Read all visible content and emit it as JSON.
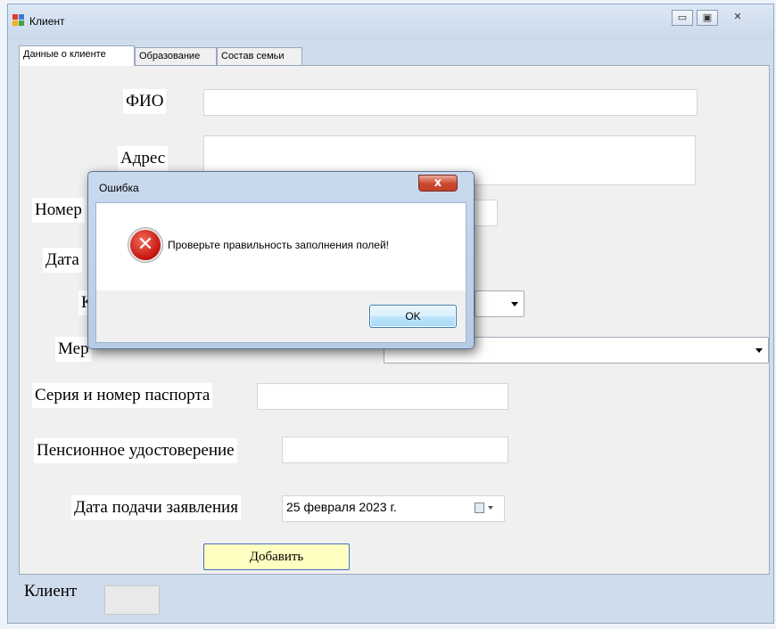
{
  "window": {
    "title": "Клиент",
    "minimize_glyph": "▭",
    "maximize_glyph": "▣",
    "close_glyph": "✕"
  },
  "tabs": [
    {
      "label": "Данные о клиенте",
      "active": true
    },
    {
      "label": "Образование",
      "active": false
    },
    {
      "label": "Состав семьи",
      "active": false
    }
  ],
  "form": {
    "fio_label": "ФИО",
    "fio_value": "",
    "address_label": "Адрес",
    "address_value": "",
    "phone_label": "Номер",
    "phone_value": "",
    "birthdate_label": "Дата",
    "category_label": "К",
    "category_value": "",
    "event_label": "Мер",
    "event_value": "",
    "passport_label": "Серия и номер паспорта",
    "passport_value": "",
    "pension_label": "Пенсионное удостоверение",
    "pension_value": "",
    "application_date_label": "Дата подачи заявления",
    "application_date_value": "25 февраля 2023 г.",
    "add_button": "Добавить"
  },
  "status": {
    "client_label": "Клиент",
    "client_value": ""
  },
  "dialog": {
    "title": "Ошибка",
    "close_glyph": "x",
    "icon": "error-icon",
    "message": "Проверьте правильность заполнения полей!",
    "ok_label": "OK"
  },
  "colors": {
    "add_button_bg": "#ffffc2",
    "error_red": "#c4140b",
    "window_frame": "#cfdcec"
  }
}
